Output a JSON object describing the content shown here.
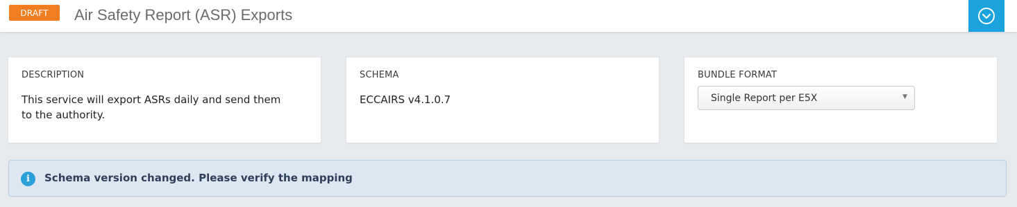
{
  "header": {
    "badge": "DRAFT",
    "title": "Air Safety Report (ASR) Exports",
    "corner_icon": "chevron-down-circle-icon"
  },
  "cards": {
    "description": {
      "label": "DESCRIPTION",
      "text": "This service will export ASRs daily and send them to the authority."
    },
    "schema": {
      "label": "SCHEMA",
      "value": "ECCAIRS v4.1.0.7"
    },
    "bundle_format": {
      "label": "BUNDLE FORMAT",
      "selected": "Single Report per E5X"
    }
  },
  "alert": {
    "icon": "info-icon",
    "message": "Schema version changed. Please verify the mapping"
  },
  "colors": {
    "badge": "#f07d20",
    "accent": "#1aa3dc",
    "alert_bg": "#dde7f1",
    "page_bg": "#e7eaed"
  }
}
